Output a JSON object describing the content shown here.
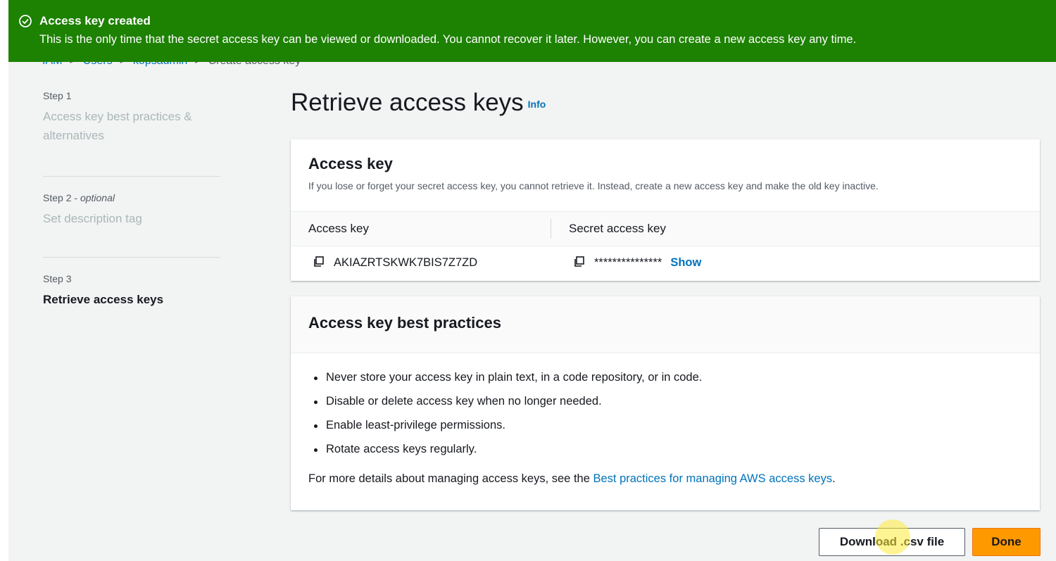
{
  "flash": {
    "title": "Access key created",
    "message": "This is the only time that the secret access key can be viewed or downloaded. You cannot recover it later. However, you can create a new access key any time.",
    "color": "#1d8102",
    "icon": "check-circle-icon"
  },
  "breadcrumb": [
    "IAM",
    "Users",
    "kopsadmin",
    "Create access key"
  ],
  "steps": [
    {
      "label": "Step 1",
      "name": "Access key best practices & alternatives"
    },
    {
      "label": "Step 2",
      "optional": "optional",
      "name": "Set description tag"
    },
    {
      "label": "Step 3",
      "name": "Retrieve access keys"
    }
  ],
  "main": {
    "title": "Retrieve access keys",
    "info": "Info"
  },
  "access_key_panel": {
    "title": "Access key",
    "description": "If you lose or forget your secret access key, you cannot retrieve it. Instead, create a new access key and make the old key inactive.",
    "col_access_key": "Access key",
    "col_secret_key": "Secret access key",
    "access_key_value": "AKIAZRTSKWK7BIS7Z7ZD",
    "secret_key_masked": "***************",
    "show_label": "Show",
    "copy_icon": "copy-icon"
  },
  "best_practices": {
    "title": "Access key best practices",
    "items": [
      "Never store your access key in plain text, in a code repository, or in code.",
      "Disable or delete access key when no longer needed.",
      "Enable least-privilege permissions.",
      "Rotate access keys regularly."
    ],
    "details_prefix": "For more details about managing access keys, see the ",
    "details_link": "Best practices for managing AWS access keys",
    "details_suffix": "."
  },
  "buttons": {
    "download": "Download .csv file",
    "done": "Done",
    "primary_color": "#ff9900"
  }
}
